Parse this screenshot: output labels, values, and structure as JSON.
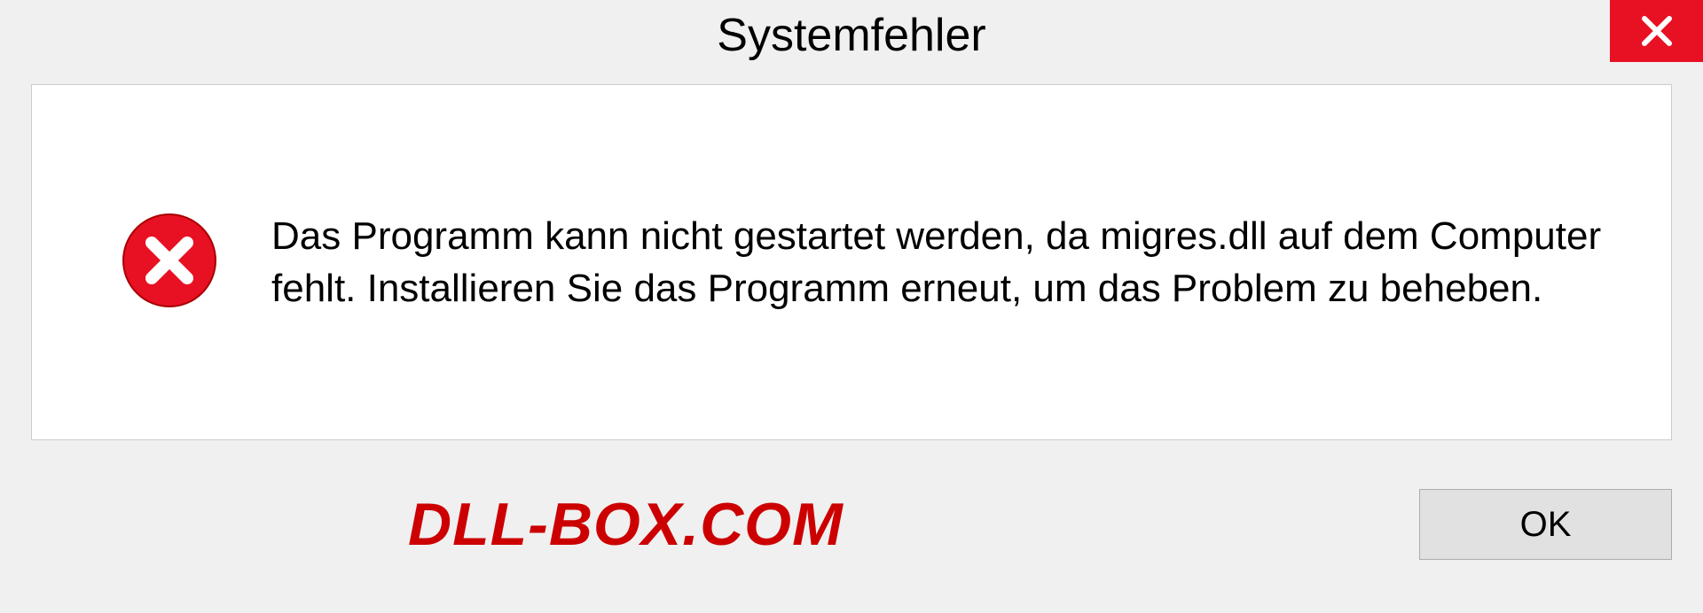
{
  "titlebar": {
    "title": "Systemfehler"
  },
  "content": {
    "message": "Das Programm kann nicht gestartet werden, da migres.dll auf dem Computer fehlt. Installieren Sie das Programm erneut, um das Problem zu beheben."
  },
  "footer": {
    "watermark": "DLL-BOX.COM",
    "ok_label": "OK"
  }
}
